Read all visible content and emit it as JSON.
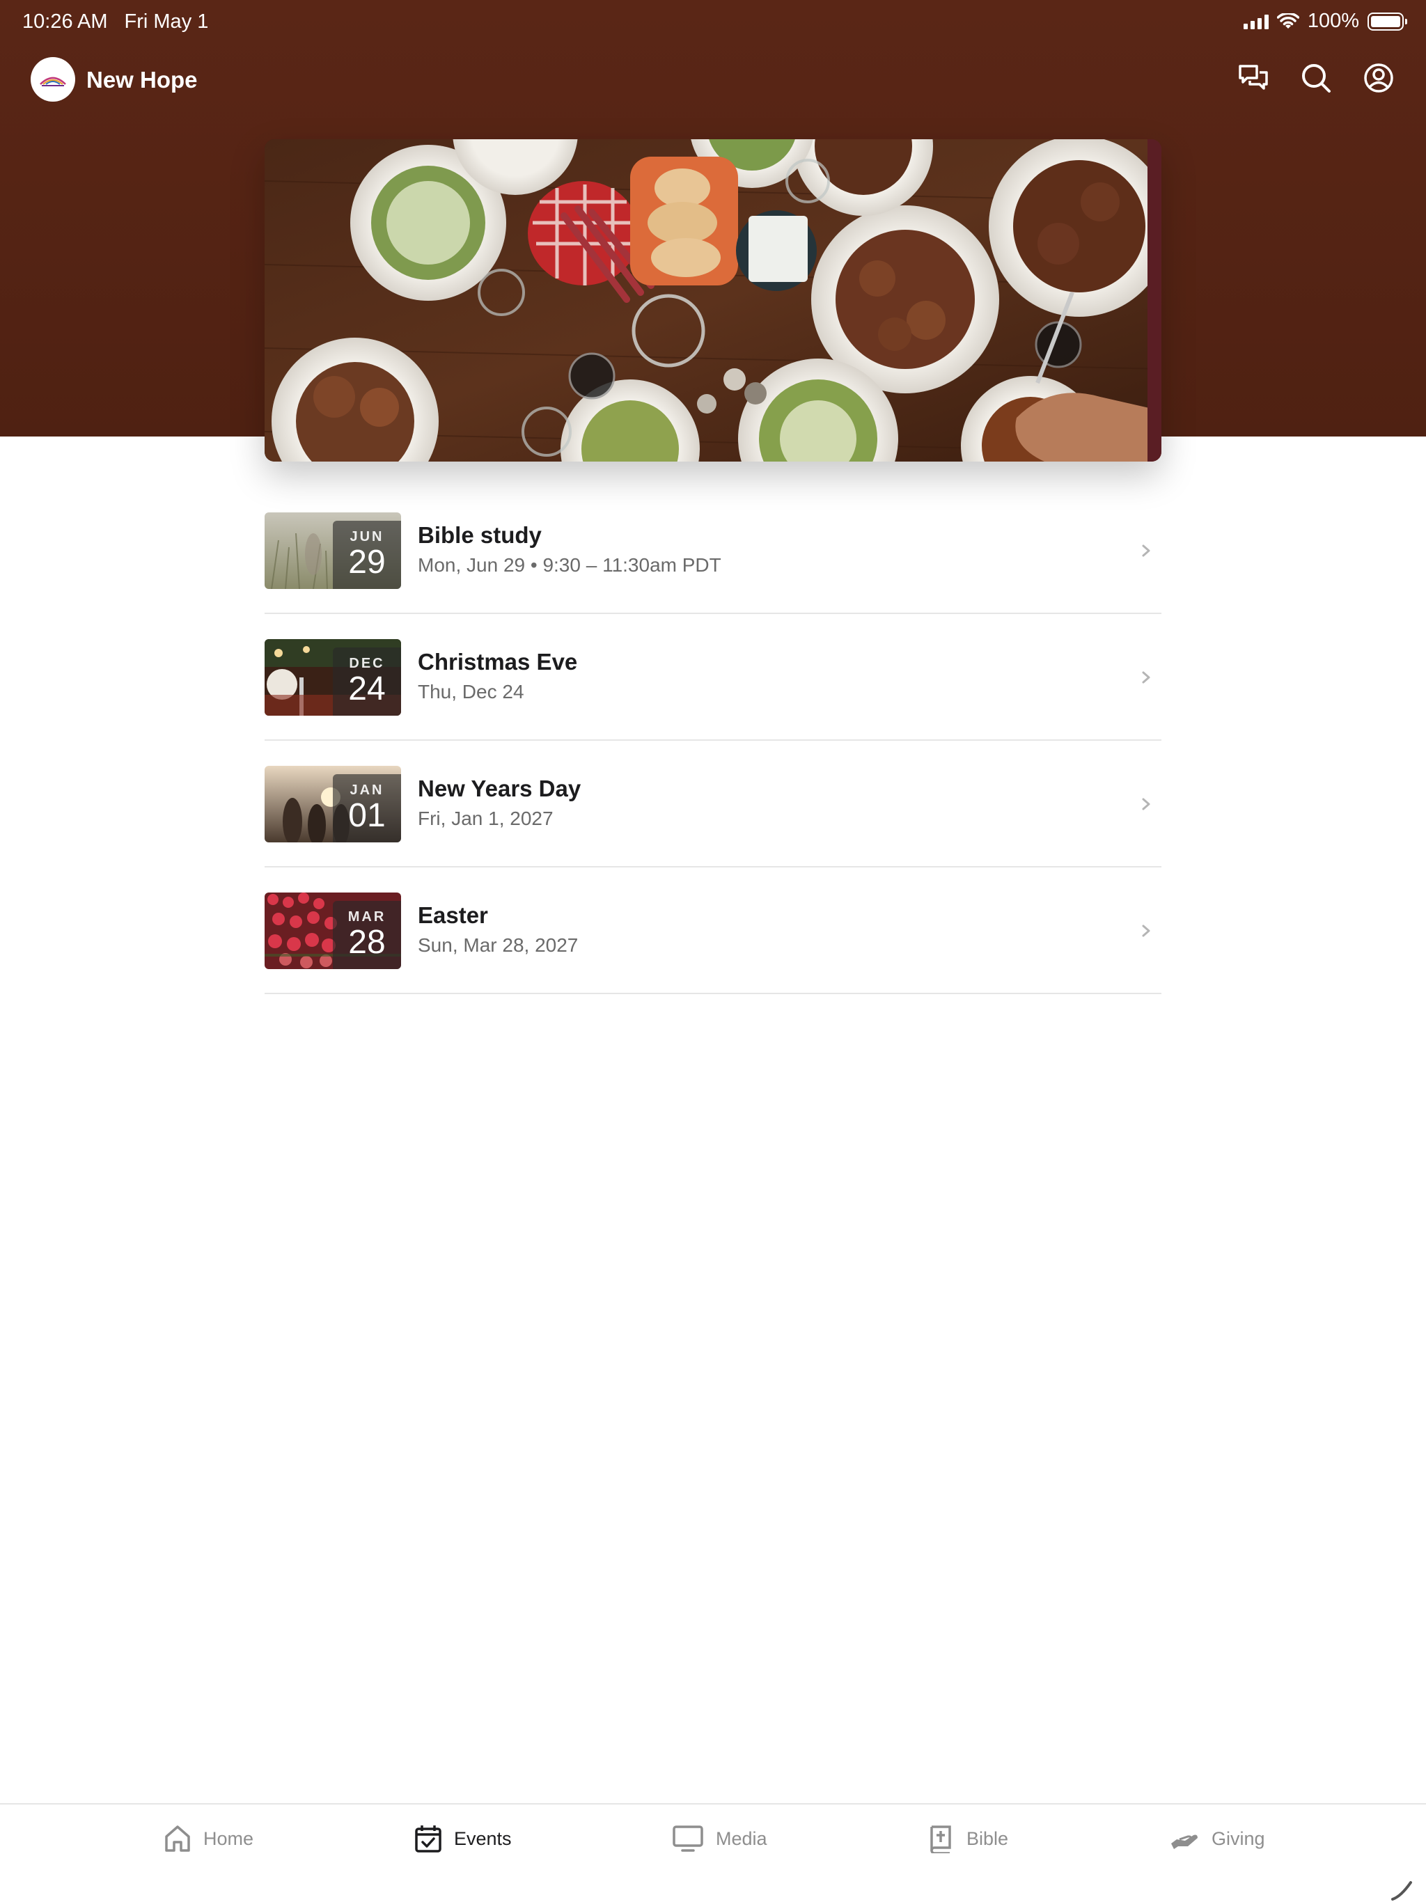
{
  "status_bar": {
    "time": "10:26 AM",
    "date": "Fri May 1",
    "battery": "100%"
  },
  "header": {
    "title": "New Hope",
    "icons": [
      "chat-icon",
      "search-icon",
      "account-icon"
    ]
  },
  "events": [
    {
      "month": "JUN",
      "day": "29",
      "title": "Bible study",
      "subtitle": "Mon, Jun 29 • 9:30 – 11:30am PDT"
    },
    {
      "month": "DEC",
      "day": "24",
      "title": "Christmas Eve",
      "subtitle": "Thu, Dec 24"
    },
    {
      "month": "JAN",
      "day": "01",
      "title": "New Years Day",
      "subtitle": "Fri, Jan 1, 2027"
    },
    {
      "month": "MAR",
      "day": "28",
      "title": "Easter",
      "subtitle": "Sun, Mar 28, 2027"
    }
  ],
  "tabs": [
    {
      "label": "Home",
      "icon": "home-icon",
      "active": false
    },
    {
      "label": "Events",
      "icon": "calendar-icon",
      "active": true
    },
    {
      "label": "Media",
      "icon": "monitor-icon",
      "active": false
    },
    {
      "label": "Bible",
      "icon": "bible-icon",
      "active": false
    },
    {
      "label": "Giving",
      "icon": "giving-hand-icon",
      "active": false
    }
  ],
  "colors": {
    "header_bg": "#561f11",
    "active_tab": "#1c1c1e",
    "inactive_tab": "#8e8e8e"
  }
}
